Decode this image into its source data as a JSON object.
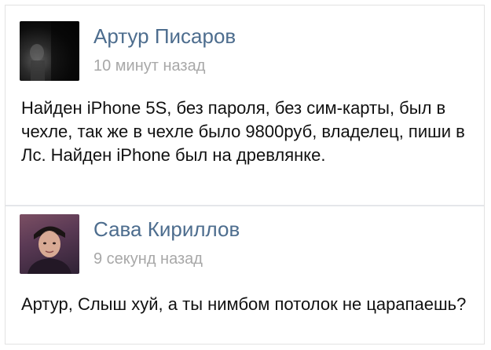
{
  "posts": [
    {
      "author": "Артур Писаров",
      "time": "10 минут назад",
      "text": "Найден iPhone 5S, без пароля, без сим-карты, был в чехле, так же в чехле было 9800руб, владелец, пиши в Лс. Найден iPhone был на древлянке."
    },
    {
      "author": "Сава Кириллов",
      "time": "9 секунд назад",
      "text": "Артур, Слыш хуй, а ты нимбом потолок не царапаешь?"
    }
  ],
  "colors": {
    "author_link": "#4d6d8e",
    "timestamp": "#a8a8a8",
    "body_text": "#111111"
  }
}
